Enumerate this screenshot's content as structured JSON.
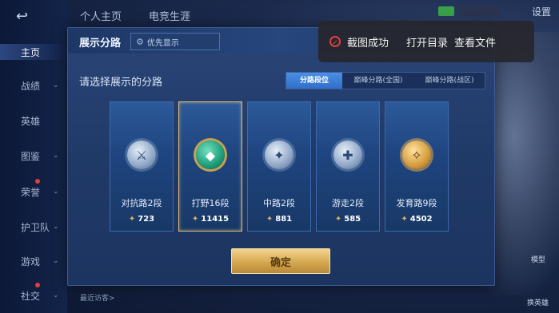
{
  "sidebar": {
    "items": [
      {
        "label": "主页",
        "chevron": false,
        "dot": false
      },
      {
        "label": "战绩",
        "chevron": true,
        "dot": false
      },
      {
        "label": "英雄",
        "chevron": false,
        "dot": false
      },
      {
        "label": "图鉴",
        "chevron": true,
        "dot": false
      },
      {
        "label": "荣誉",
        "chevron": true,
        "dot": true
      },
      {
        "label": "护卫队",
        "chevron": true,
        "dot": false
      },
      {
        "label": "游戏",
        "chevron": true,
        "dot": false
      },
      {
        "label": "社交",
        "chevron": true,
        "dot": true
      }
    ],
    "chevron_glyph": "⌄",
    "back_glyph": "↩"
  },
  "top": {
    "tab1": "个人主页",
    "tab2": "电竞生涯",
    "settings": "设置"
  },
  "panel": {
    "title": "展示分路",
    "priority_button": "优先显示",
    "priority_icon_glyph": "⚙",
    "subtitle": "请选择展示的分路",
    "segments": [
      "分路段位",
      "巅峰分路(全国)",
      "巅峰分路(战区)"
    ],
    "active_segment": 0,
    "confirm": "确定"
  },
  "cards": [
    {
      "rank": "对抗路2段",
      "score": "723",
      "emblem": "silver",
      "glyph": "⚔",
      "selected": false
    },
    {
      "rank": "打野16段",
      "score": "11415",
      "emblem": "green",
      "glyph": "◆",
      "selected": true
    },
    {
      "rank": "中路2段",
      "score": "881",
      "emblem": "silver",
      "glyph": "✦",
      "selected": false
    },
    {
      "rank": "游走2段",
      "score": "585",
      "emblem": "silver",
      "glyph": "✚",
      "selected": false
    },
    {
      "rank": "发育路9段",
      "score": "4502",
      "emblem": "gold",
      "glyph": "✧",
      "selected": false
    }
  ],
  "score_glyph": "✦",
  "toast": {
    "message": "截图成功",
    "icon_glyph": "✓",
    "open_dir": "打开目录",
    "view_file": "查看文件"
  },
  "bottom": {
    "visitors": "最近访客>",
    "model": "模型",
    "hero": "换英雄"
  }
}
